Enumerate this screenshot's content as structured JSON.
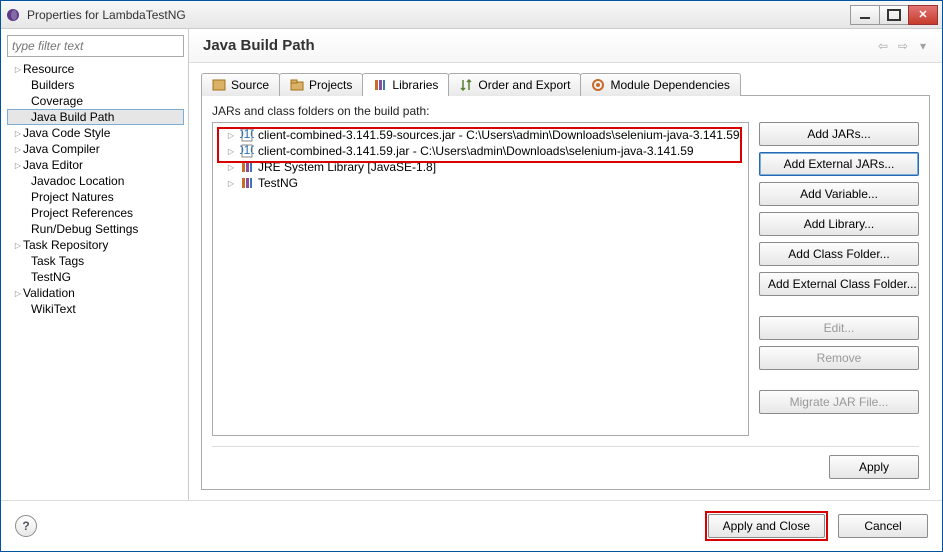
{
  "title": "Properties for LambdaTestNG",
  "filter_placeholder": "type filter text",
  "sidebar": {
    "items": [
      {
        "label": "Resource",
        "caret": true
      },
      {
        "label": "Builders",
        "child": true
      },
      {
        "label": "Coverage",
        "child": true
      },
      {
        "label": "Java Build Path",
        "child": true,
        "selected": true
      },
      {
        "label": "Java Code Style",
        "caret": true
      },
      {
        "label": "Java Compiler",
        "caret": true
      },
      {
        "label": "Java Editor",
        "caret": true
      },
      {
        "label": "Javadoc Location",
        "child": true
      },
      {
        "label": "Project Natures",
        "child": true
      },
      {
        "label": "Project References",
        "child": true
      },
      {
        "label": "Run/Debug Settings",
        "child": true
      },
      {
        "label": "Task Repository",
        "caret": true
      },
      {
        "label": "Task Tags",
        "child": true
      },
      {
        "label": "TestNG",
        "child": true
      },
      {
        "label": "Validation",
        "caret": true
      },
      {
        "label": "WikiText",
        "child": true
      }
    ]
  },
  "header": {
    "title": "Java Build Path"
  },
  "tabs": {
    "source": "Source",
    "projects": "Projects",
    "libraries": "Libraries",
    "order": "Order and Export",
    "moduleDeps": "Module Dependencies"
  },
  "panel": {
    "label": "JARs and class folders on the build path:",
    "entries": [
      {
        "type": "jar",
        "label": "client-combined-3.141.59-sources.jar - C:\\Users\\admin\\Downloads\\selenium-java-3.141.59"
      },
      {
        "type": "jar",
        "label": "client-combined-3.141.59.jar - C:\\Users\\admin\\Downloads\\selenium-java-3.141.59"
      },
      {
        "type": "lib",
        "label": "JRE System Library [JavaSE-1.8]"
      },
      {
        "type": "lib",
        "label": "TestNG"
      }
    ],
    "buttons": {
      "addJars": "Add JARs...",
      "addExternalJars": "Add External JARs...",
      "addVariable": "Add Variable...",
      "addLibrary": "Add Library...",
      "addClassFolder": "Add Class Folder...",
      "addExtClassFolder": "Add External Class Folder...",
      "edit": "Edit...",
      "remove": "Remove",
      "migrate": "Migrate JAR File..."
    },
    "apply": "Apply"
  },
  "footer": {
    "applyClose": "Apply and Close",
    "cancel": "Cancel"
  }
}
